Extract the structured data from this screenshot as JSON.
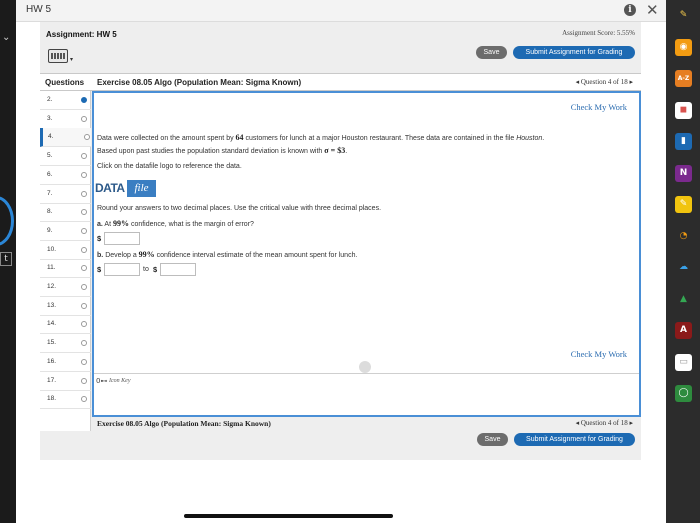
{
  "window": {
    "title": "HW 5",
    "info_label": "i",
    "close_label": "✕"
  },
  "assignment": {
    "title": "Assignment: HW 5",
    "score": "Assignment Score: 5.55%",
    "save_label": "Save",
    "submit_label": "Submit Assignment for Grading"
  },
  "header": {
    "questions_label": "Questions",
    "exercise_title": "Exercise 08.05 Algo (Population Mean: Sigma Known)",
    "question_nav": "◂ Question 4 of 18 ▸"
  },
  "questions": [
    {
      "num": "2.",
      "status": "done"
    },
    {
      "num": "3.",
      "status": "empty"
    },
    {
      "num": "4.",
      "status": "active"
    },
    {
      "num": "5.",
      "status": "empty"
    },
    {
      "num": "6.",
      "status": "empty"
    },
    {
      "num": "7.",
      "status": "empty"
    },
    {
      "num": "8.",
      "status": "empty"
    },
    {
      "num": "9.",
      "status": "empty"
    },
    {
      "num": "10.",
      "status": "empty"
    },
    {
      "num": "11.",
      "status": "empty"
    },
    {
      "num": "12.",
      "status": "empty"
    },
    {
      "num": "13.",
      "status": "empty"
    },
    {
      "num": "14.",
      "status": "empty"
    },
    {
      "num": "15.",
      "status": "empty"
    },
    {
      "num": "16.",
      "status": "empty"
    },
    {
      "num": "17.",
      "status": "empty"
    },
    {
      "num": "18.",
      "status": "empty"
    }
  ],
  "content": {
    "check_my_work": "Check My Work",
    "intro_1": "Data were collected on the amount spent by",
    "customers_count": "64",
    "intro_2": "customers for lunch at a major Houston restaurant. These data are contained in the file",
    "file_name": "Houston",
    "intro_3": ".",
    "intro_line2_a": "Based upon past studies the population standard deviation is known with",
    "sigma_expr": "σ = $3",
    "intro_line2_b": ".",
    "click_ref": "Click on the datafile logo to reference the data.",
    "datafile_data": "DATA",
    "datafile_file": "file",
    "round_note": "Round your answers to two decimal places. Use the critical value with three decimal places.",
    "part_a_label": "a.",
    "part_a_1": "At",
    "part_a_conf": "99%",
    "part_a_2": "confidence, what is the margin of error?",
    "part_b_label": "b.",
    "part_b_1": "Develop a",
    "part_b_conf": "99%",
    "part_b_2": "confidence interval estimate of the mean amount spent for lunch.",
    "dollar": "$",
    "to_label": "to",
    "key_icon": "0⊷",
    "key_label": "Icon Key"
  },
  "footer": {
    "exercise_title": "Exercise 08.05 Algo (Population Mean: Sigma Known)",
    "question_nav": "◂ Question 4 of 18 ▸",
    "save_label": "Save",
    "submit_label": "Submit Assignment for Grading"
  },
  "colors": {
    "accent": "#1d6ab3",
    "frame": "#4a8fd6",
    "link": "#2b6cb0"
  },
  "dock_icons": [
    "pencil-icon",
    "rss-icon",
    "dictionary-icon",
    "office-icon",
    "book-icon",
    "onenote-icon",
    "notes-icon",
    "handwriting-icon",
    "onedrive-icon",
    "google-drive-icon",
    "acrobat-icon",
    "note-icon",
    "circle-app-icon"
  ]
}
